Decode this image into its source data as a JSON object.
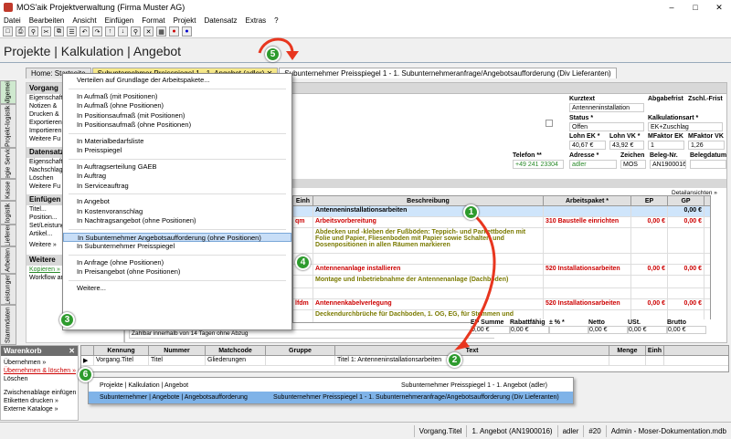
{
  "window": {
    "title": "MOS'aik Projektverwaltung (Firma Muster AG)"
  },
  "menu": [
    "Datei",
    "Bearbeiten",
    "Ansicht",
    "Einfügen",
    "Format",
    "Projekt",
    "Datensatz",
    "Extras",
    "?"
  ],
  "page_title": "Projekte | Kalkulation | Angebot",
  "tabs": [
    "Home: Startseite",
    "Subunternehmer Preisspiegel 1 - 1. Angebot (adler)",
    "Subunternehmer Preisspiegel 1 - 1. Subunternehmeranfrage/Angebotsaufforderung (Div Lieferanten)"
  ],
  "vtabs": [
    "Allgemein",
    "Projekt-logistik",
    "Regie Service",
    "Kasse",
    "logistik",
    "Lieferer",
    "Arbeiten",
    "Leistungen",
    "Stammdaten"
  ],
  "left": {
    "sec1": "Vorgang",
    "sec1_items": [
      "Eigenschaften",
      "Notizen &",
      "Drucken &",
      "Exportieren",
      "Importieren",
      "Weitere Fu"
    ],
    "sec2": "Datensatz",
    "sec2_items": [
      "Eigenschaften",
      "Nachschlagen",
      "Löschen",
      "Weitere Fu"
    ],
    "sec3": "Einfügen",
    "sec3_items": [
      "Titel...",
      "Position...",
      "Set/Leistung",
      "Artikel..."
    ],
    "weitere": "Weitere »",
    "sec4": "Weitere",
    "sec4_items": [
      "Kopieren »",
      "Workflow anzeigen..."
    ]
  },
  "context_menu": [
    "Verteilen auf Grundlage der Arbeitspakete...",
    "-",
    "In Aufmaß (mit Positionen)",
    "In Aufmaß (ohne Positionen)",
    "In Positionsaufmaß (mit Positionen)",
    "In Positionsaufmaß (ohne Positionen)",
    "-",
    "In Materialbedarfsliste",
    "In Preisspiegel",
    "-",
    "In Auftragserteilung GAEB",
    "In Auftrag",
    "In Serviceauftrag",
    "-",
    "In Angebot",
    "In Kostenvoranschlag",
    "In Nachtragsangebot (ohne Positionen)",
    "-",
    "In Subunternehmer Angebotsaufforderung (ohne Positionen)",
    "In Subunternehmer Preisspiegel",
    "-",
    "In Anfrage (ohne Positionen)",
    "In Preisangebot (ohne Positionen)",
    "-",
    "Weitere..."
  ],
  "header": {
    "kurztext_lbl": "Kurztext",
    "kurztext": "Antenneninstallation",
    "abgabefrist_lbl": "Abgabefrist",
    "zschl_lbl": "Zschl.-Frist",
    "status_lbl": "Status *",
    "status": "Offen",
    "kalk_lbl": "Kalkulationsart *",
    "kalk": "EK+Zuschlag",
    "lohnek_lbl": "Lohn EK *",
    "lohnek": "40,67 €",
    "lohnvk_lbl": "Lohn VK *",
    "lohnvk": "43,92 €",
    "mfek_lbl": "MFaktor EK",
    "mfek": "1",
    "mfvk_lbl": "MFaktor VK",
    "mfvk": "1,26",
    "telefon_lbl": "Telefon **",
    "telefon": "+49 241 23304",
    "adresse_lbl": "Adresse *",
    "adresse": "adler",
    "zeichen_lbl": "Zeichen",
    "zeichen": "MOS",
    "beleg_lbl": "Beleg-Nr.",
    "beleg": "AN1900016",
    "belegdatum_lbl": "Belegdatum",
    "detail_link": "Detailansichten »"
  },
  "table": {
    "cols": [
      "Einh",
      "Beschreibung",
      "Arbeitspaket *",
      "EP",
      "GP"
    ],
    "rows": [
      {
        "einh": "",
        "desc": "Antenneninstallationsarbeiten",
        "ap": "",
        "ep": "",
        "gp": "0,00 €",
        "style": "title"
      },
      {
        "einh": "qm",
        "desc": "Arbeitsvorbereitung",
        "ap": "310 Baustelle einrichten",
        "ep": "0,00 €",
        "gp": "0,00 €",
        "style": "red"
      },
      {
        "einh": "",
        "desc": "Abdecken und -kleben der Fußböden: Teppich- und Parkettboden mit Folie und Papier, Fliesenboden mit Papier sowie Schalter- und Dosenpositionen in allen Räumen markieren",
        "ap": "",
        "ep": "",
        "gp": "",
        "style": "olive"
      },
      {
        "einh": "",
        "desc": "",
        "ap": "",
        "ep": "",
        "gp": "",
        "style": ""
      },
      {
        "einh": "",
        "desc": "Antennenanlage installieren",
        "ap": "520 Installationsarbeiten",
        "ep": "0,00 €",
        "gp": "0,00 €",
        "style": "red"
      },
      {
        "einh": "",
        "desc": "Montage und Inbetriebnahme der Antennenanlage (Dachboden)",
        "ap": "",
        "ep": "",
        "gp": "",
        "style": "olive"
      },
      {
        "einh": "",
        "desc": "",
        "ap": "",
        "ep": "",
        "gp": "",
        "style": ""
      },
      {
        "einh": "lfdm",
        "desc": "Antennenkabelverlegung",
        "ap": "520 Installationsarbeiten",
        "ep": "0,00 €",
        "gp": "0,00 €",
        "style": "red"
      },
      {
        "einh": "",
        "desc": "Deckendurchbrüche für Dachboden, 1. OG, EG, für Stemmen und",
        "ap": "",
        "ep": "",
        "gp": "",
        "style": "olive"
      }
    ]
  },
  "sums": {
    "labels": [
      "EP Summe",
      "Rabattfähig",
      "± % *",
      "Netto",
      "USt.",
      "Brutto"
    ],
    "values": [
      "0,00 €",
      "0,00 €",
      "",
      "0,00 €",
      "0,00 €",
      "0,00 €"
    ]
  },
  "footer_note": "Zahlbar innerhalb von 14 Tagen ohne Abzug",
  "warenkorb": {
    "title": "Warenkorb",
    "items": [
      "Übernehmen »",
      "Übernehmen & löschen »",
      "Löschen",
      "",
      "Zwischenablage einfügen",
      "Etiketten drucken »",
      "Externe Kataloge »"
    ]
  },
  "wkgrid": {
    "cols": [
      "Kennung",
      "Nummer",
      "Matchcode",
      "Gruppe",
      "Text",
      "Menge",
      "Einh"
    ],
    "row": [
      "Vorgang.Titel",
      "Titel",
      "Gliederungen",
      "",
      "Titel 1: Antenneninstallationsarbeiten",
      "",
      ""
    ]
  },
  "popup": [
    {
      "left": "Projekte | Kalkulation | Angebot",
      "right": "Subunternehmer Preisspiegel 1 - 1. Angebot (adler)"
    },
    {
      "left": "Subunternehmer | Angebote | Angebotsaufforderung",
      "right": "Subunternehmer Preisspiegel 1 - 1. Subunternehmeranfrage/Angebotsaufforderung (Div Lieferanten)"
    }
  ],
  "status": [
    "Vorgang.Titel",
    "1. Angebot (AN1900016)",
    "adler",
    "#20",
    "Admin - Moser-Dokumentation.mdb"
  ],
  "badges": [
    "1",
    "2",
    "3",
    "4",
    "5",
    "6"
  ],
  "colors": {
    "accent_green": "#2e9b2e",
    "highlight": "#c8def7",
    "arrow": "#e8361f"
  }
}
